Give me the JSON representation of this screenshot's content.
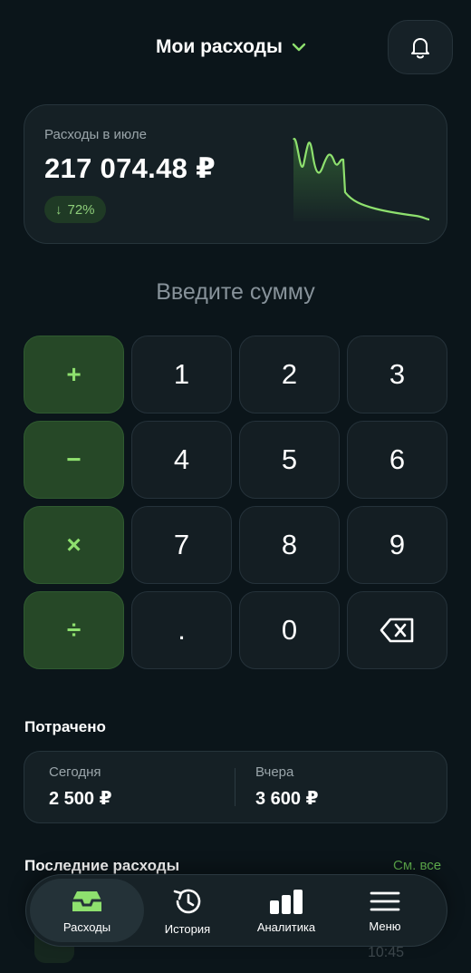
{
  "header": {
    "title": "Мои расходы",
    "chevron_icon": "chevron-down-icon",
    "bell_icon": "bell-icon"
  },
  "summary": {
    "label": "Расходы в июле",
    "value": "217 074.48 ₽",
    "change": "72%",
    "change_icon": "arrow-down-icon"
  },
  "prompt": "Введите сумму",
  "keypad": {
    "keys": [
      "+",
      "1",
      "2",
      "3",
      "−",
      "4",
      "5",
      "6",
      "×",
      "7",
      "8",
      "9",
      "÷",
      ".",
      "0",
      "backspace"
    ]
  },
  "spent": {
    "title": "Потрачено",
    "today_label": "Сегодня",
    "today_value": "2 500 ₽",
    "yesterday_label": "Вчера",
    "yesterday_value": "3 600 ₽"
  },
  "recent": {
    "title": "Последние расходы",
    "see_all": "См. все",
    "partial_time": "10:45"
  },
  "tabs": [
    {
      "label": "Расходы",
      "icon": "inbox-icon",
      "active": true
    },
    {
      "label": "История",
      "icon": "history-icon",
      "active": false
    },
    {
      "label": "Аналитика",
      "icon": "bar-chart-icon",
      "active": false
    },
    {
      "label": "Меню",
      "icon": "menu-icon",
      "active": false
    }
  ],
  "colors": {
    "accent": "#8ee06e",
    "background": "#0b151a",
    "card": "#152025",
    "op_key": "#264827"
  }
}
